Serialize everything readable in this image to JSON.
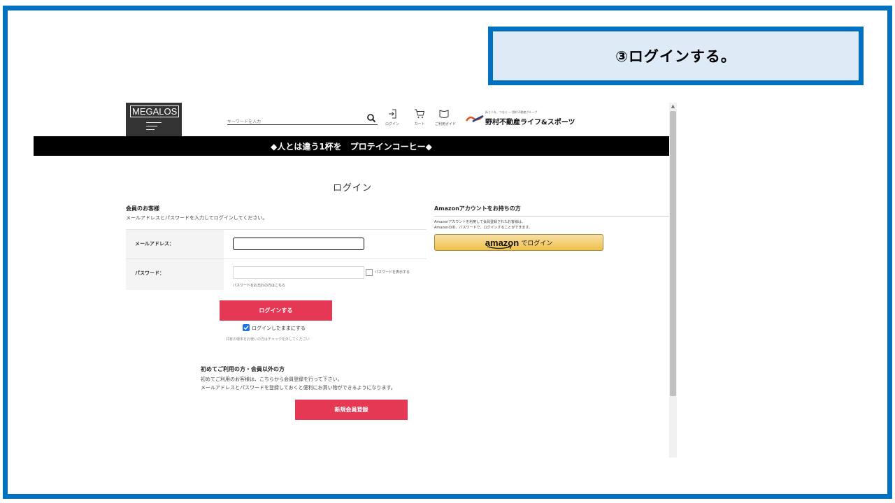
{
  "callout": {
    "text": "③ログインする。"
  },
  "header": {
    "logo_text": "MEGALOS",
    "search_placeholder": "キーワードを入力",
    "icons": [
      {
        "label": "ログイン",
        "icon": "login-icon"
      },
      {
        "label": "カート",
        "icon": "cart-icon"
      },
      {
        "label": "ご利用ガイド",
        "icon": "guide-book-icon"
      }
    ],
    "brand_tagline": "街と人を、つなぐ ― 野村不動産グループ",
    "brand_name": "野村不動産ライフ&スポーツ"
  },
  "banner": {
    "text": "◆人とは違う1杯を　プロテインコーヒー◆"
  },
  "page": {
    "title": "ログイン"
  },
  "member": {
    "heading": "会員のお客様",
    "description": "メールアドレスとパスワードを入力してログインしてください。",
    "email_label": "メールアドレス：",
    "email_value": "",
    "password_label": "パスワード：",
    "password_value": "",
    "show_password_label": "パスワードを表示する",
    "forgot_password": "パスワードをお忘れの方はこちら",
    "login_button": "ログインする",
    "keep_logged_in": "ログインしたままにする",
    "keep_note": "共有の端末をお使いの方はチェックを外してください"
  },
  "new_customer": {
    "heading": "初めてご利用の方・会員以外の方",
    "desc1": "初めてご利用のお客様は、こちらから会員登録を行って下さい。",
    "desc2": "メールアドレスとパスワードを登録しておくと便利にお買い物ができるようになります。",
    "register_button": "新規会員登録"
  },
  "amazon": {
    "heading": "Amazonアカウントをお持ちの方",
    "desc1": "Amazonアカウントを利用して会員登録されたお客様は、",
    "desc2": "AmazonのID、パスワードで、ログインすることができます。",
    "button_brand": "amazon",
    "button_suffix": "でログイン"
  },
  "colors": {
    "frame": "#0070c0",
    "callout_bg": "#deebf7",
    "primary_button": "#e43855",
    "amazon_button": "#f0c14b",
    "checkbox": "#1a73e8"
  }
}
